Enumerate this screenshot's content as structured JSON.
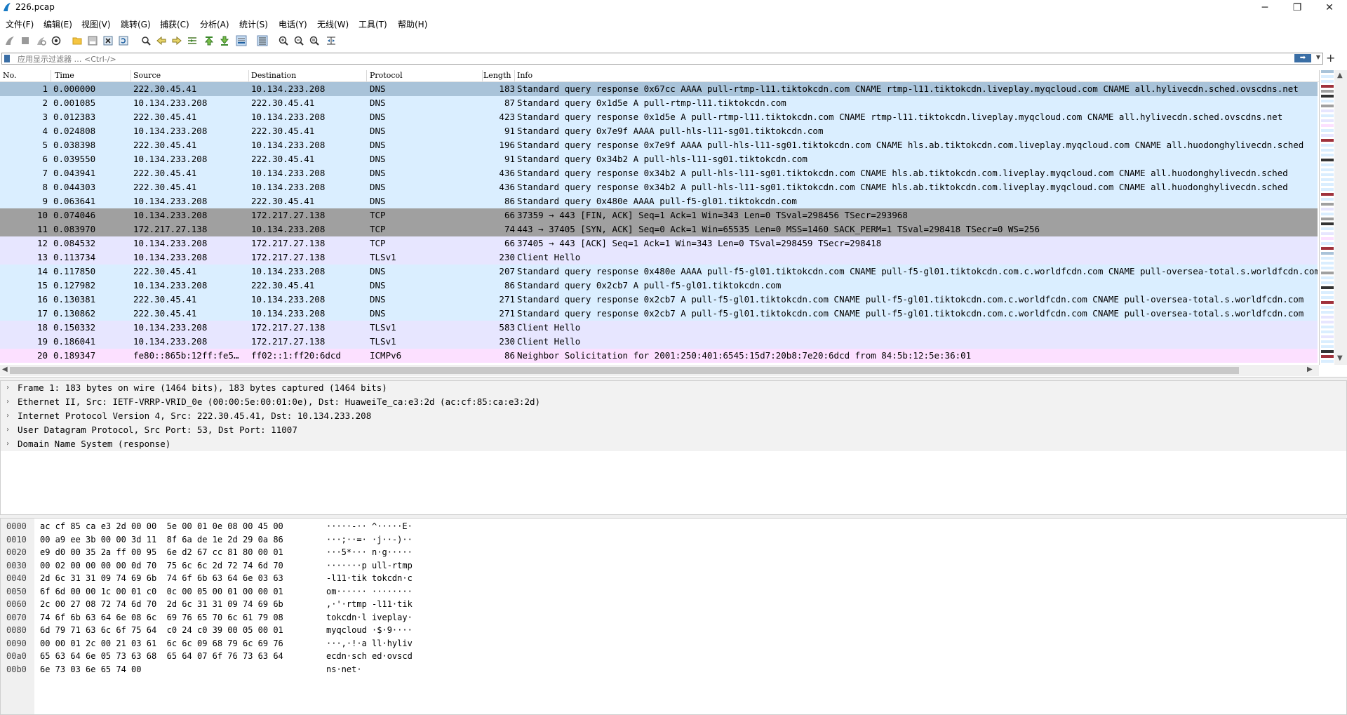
{
  "window": {
    "title": "226.pcap",
    "minimize": "─",
    "maximize": "❐",
    "close": "✕"
  },
  "menu": [
    "文件(F)",
    "编辑(E)",
    "视图(V)",
    "跳转(G)",
    "捕获(C)",
    "分析(A)",
    "统计(S)",
    "电话(Y)",
    "无线(W)",
    "工具(T)",
    "帮助(H)"
  ],
  "filter": {
    "placeholder": "应用显示过滤器 … <Ctrl-/>",
    "apply_label": "➡",
    "add_label": "+"
  },
  "packet_list": {
    "columns": [
      "No.",
      "Time",
      "Source",
      "Destination",
      "Protocol",
      "Length",
      "Info"
    ],
    "rows": [
      {
        "no": "1",
        "time": "0.000000",
        "src": "222.30.45.41",
        "dst": "10.134.233.208",
        "proto": "DNS",
        "len": "183",
        "info": "Standard query response 0x67cc AAAA pull-rtmp-l11.tiktokcdn.com CNAME rtmp-l11.tiktokcdn.liveplay.myqcloud.com CNAME all.hylivecdn.sched.ovscdns.net",
        "bg": "#a9c3d9"
      },
      {
        "no": "2",
        "time": "0.001085",
        "src": "10.134.233.208",
        "dst": "222.30.45.41",
        "proto": "DNS",
        "len": "87",
        "info": "Standard query 0x1d5e A pull-rtmp-l11.tiktokcdn.com",
        "bg": "#daeeff"
      },
      {
        "no": "3",
        "time": "0.012383",
        "src": "222.30.45.41",
        "dst": "10.134.233.208",
        "proto": "DNS",
        "len": "423",
        "info": "Standard query response 0x1d5e A pull-rtmp-l11.tiktokcdn.com CNAME rtmp-l11.tiktokcdn.liveplay.myqcloud.com CNAME all.hylivecdn.sched.ovscdns.net",
        "bg": "#daeeff"
      },
      {
        "no": "4",
        "time": "0.024808",
        "src": "10.134.233.208",
        "dst": "222.30.45.41",
        "proto": "DNS",
        "len": "91",
        "info": "Standard query 0x7e9f AAAA pull-hls-l11-sg01.tiktokcdn.com",
        "bg": "#daeeff"
      },
      {
        "no": "5",
        "time": "0.038398",
        "src": "222.30.45.41",
        "dst": "10.134.233.208",
        "proto": "DNS",
        "len": "196",
        "info": "Standard query response 0x7e9f AAAA pull-hls-l11-sg01.tiktokcdn.com CNAME hls.ab.tiktokcdn.com.liveplay.myqcloud.com CNAME all.huodonghylivecdn.sched",
        "bg": "#daeeff"
      },
      {
        "no": "6",
        "time": "0.039550",
        "src": "10.134.233.208",
        "dst": "222.30.45.41",
        "proto": "DNS",
        "len": "91",
        "info": "Standard query 0x34b2 A pull-hls-l11-sg01.tiktokcdn.com",
        "bg": "#daeeff"
      },
      {
        "no": "7",
        "time": "0.043941",
        "src": "222.30.45.41",
        "dst": "10.134.233.208",
        "proto": "DNS",
        "len": "436",
        "info": "Standard query response 0x34b2 A pull-hls-l11-sg01.tiktokcdn.com CNAME hls.ab.tiktokcdn.com.liveplay.myqcloud.com CNAME all.huodonghylivecdn.sched",
        "bg": "#daeeff"
      },
      {
        "no": "8",
        "time": "0.044303",
        "src": "222.30.45.41",
        "dst": "10.134.233.208",
        "proto": "DNS",
        "len": "436",
        "info": "Standard query response 0x34b2 A pull-hls-l11-sg01.tiktokcdn.com CNAME hls.ab.tiktokcdn.com.liveplay.myqcloud.com CNAME all.huodonghylivecdn.sched",
        "bg": "#daeeff"
      },
      {
        "no": "9",
        "time": "0.063641",
        "src": "10.134.233.208",
        "dst": "222.30.45.41",
        "proto": "DNS",
        "len": "86",
        "info": "Standard query 0x480e AAAA pull-f5-gl01.tiktokcdn.com",
        "bg": "#daeeff"
      },
      {
        "no": "10",
        "time": "0.074046",
        "src": "10.134.233.208",
        "dst": "172.217.27.138",
        "proto": "TCP",
        "len": "66",
        "info": "37359 → 443 [FIN, ACK] Seq=1 Ack=1 Win=343 Len=0 TSval=298456 TSecr=293968",
        "bg": "#a0a0a0"
      },
      {
        "no": "11",
        "time": "0.083970",
        "src": "172.217.27.138",
        "dst": "10.134.233.208",
        "proto": "TCP",
        "len": "74",
        "info": "443 → 37405 [SYN, ACK] Seq=0 Ack=1 Win=65535 Len=0 MSS=1460 SACK_PERM=1 TSval=298418 TSecr=0 WS=256",
        "bg": "#a0a0a0"
      },
      {
        "no": "12",
        "time": "0.084532",
        "src": "10.134.233.208",
        "dst": "172.217.27.138",
        "proto": "TCP",
        "len": "66",
        "info": "37405 → 443 [ACK] Seq=1 Ack=1 Win=343 Len=0 TSval=298459 TSecr=298418",
        "bg": "#e7e6ff"
      },
      {
        "no": "13",
        "time": "0.113734",
        "src": "10.134.233.208",
        "dst": "172.217.27.138",
        "proto": "TLSv1",
        "len": "230",
        "info": "Client Hello",
        "bg": "#e7e6ff"
      },
      {
        "no": "14",
        "time": "0.117850",
        "src": "222.30.45.41",
        "dst": "10.134.233.208",
        "proto": "DNS",
        "len": "207",
        "info": "Standard query response 0x480e AAAA pull-f5-gl01.tiktokcdn.com CNAME pull-f5-gl01.tiktokcdn.com.c.worldfcdn.com CNAME pull-oversea-total.s.worldfcdn.com",
        "bg": "#daeeff"
      },
      {
        "no": "15",
        "time": "0.127982",
        "src": "10.134.233.208",
        "dst": "222.30.45.41",
        "proto": "DNS",
        "len": "86",
        "info": "Standard query 0x2cb7 A pull-f5-gl01.tiktokcdn.com",
        "bg": "#daeeff"
      },
      {
        "no": "16",
        "time": "0.130381",
        "src": "222.30.45.41",
        "dst": "10.134.233.208",
        "proto": "DNS",
        "len": "271",
        "info": "Standard query response 0x2cb7 A pull-f5-gl01.tiktokcdn.com CNAME pull-f5-gl01.tiktokcdn.com.c.worldfcdn.com CNAME pull-oversea-total.s.worldfcdn.com",
        "bg": "#daeeff"
      },
      {
        "no": "17",
        "time": "0.130862",
        "src": "222.30.45.41",
        "dst": "10.134.233.208",
        "proto": "DNS",
        "len": "271",
        "info": "Standard query response 0x2cb7 A pull-f5-gl01.tiktokcdn.com CNAME pull-f5-gl01.tiktokcdn.com.c.worldfcdn.com CNAME pull-oversea-total.s.worldfcdn.com",
        "bg": "#daeeff"
      },
      {
        "no": "18",
        "time": "0.150332",
        "src": "10.134.233.208",
        "dst": "172.217.27.138",
        "proto": "TLSv1",
        "len": "583",
        "info": "Client Hello",
        "bg": "#e7e6ff"
      },
      {
        "no": "19",
        "time": "0.186041",
        "src": "10.134.233.208",
        "dst": "172.217.27.138",
        "proto": "TLSv1",
        "len": "230",
        "info": "Client Hello",
        "bg": "#e7e6ff"
      },
      {
        "no": "20",
        "time": "0.189347",
        "src": "fe80::865b:12ff:fe5…",
        "dst": "ff02::1:ff20:6dcd",
        "proto": "ICMPv6",
        "len": "86",
        "info": "Neighbor Solicitation for 2001:250:401:6545:15d7:20b8:7e20:6dcd from 84:5b:12:5e:36:01",
        "bg": "#fce0ff"
      }
    ]
  },
  "details": [
    "Frame 1: 183 bytes on wire (1464 bits), 183 bytes captured (1464 bits)",
    "Ethernet II, Src: IETF-VRRP-VRID_0e (00:00:5e:00:01:0e), Dst: HuaweiTe_ca:e3:2d (ac:cf:85:ca:e3:2d)",
    "Internet Protocol Version 4, Src: 222.30.45.41, Dst: 10.134.233.208",
    "User Datagram Protocol, Src Port: 53, Dst Port: 11007",
    "Domain Name System (response)"
  ],
  "bytes": [
    {
      "off": "0000",
      "hex": "ac cf 85 ca e3 2d 00 00  5e 00 01 0e 08 00 45 00",
      "ascii": "·····-·· ^·····E·"
    },
    {
      "off": "0010",
      "hex": "00 a9 ee 3b 00 00 3d 11  8f 6a de 1e 2d 29 0a 86",
      "ascii": "···;··=· ·j··-)··"
    },
    {
      "off": "0020",
      "hex": "e9 d0 00 35 2a ff 00 95  6e d2 67 cc 81 80 00 01",
      "ascii": "···5*··· n·g·····"
    },
    {
      "off": "0030",
      "hex": "00 02 00 00 00 00 0d 70  75 6c 6c 2d 72 74 6d 70",
      "ascii": "·······p ull-rtmp"
    },
    {
      "off": "0040",
      "hex": "2d 6c 31 31 09 74 69 6b  74 6f 6b 63 64 6e 03 63",
      "ascii": "-l11·tik tokcdn·c"
    },
    {
      "off": "0050",
      "hex": "6f 6d 00 00 1c 00 01 c0  0c 00 05 00 01 00 00 01",
      "ascii": "om······ ········"
    },
    {
      "off": "0060",
      "hex": "2c 00 27 08 72 74 6d 70  2d 6c 31 31 09 74 69 6b",
      "ascii": ",·'·rtmp -l11·tik"
    },
    {
      "off": "0070",
      "hex": "74 6f 6b 63 64 6e 08 6c  69 76 65 70 6c 61 79 08",
      "ascii": "tokcdn·l iveplay·"
    },
    {
      "off": "0080",
      "hex": "6d 79 71 63 6c 6f 75 64  c0 24 c0 39 00 05 00 01",
      "ascii": "myqcloud ·$·9····"
    },
    {
      "off": "0090",
      "hex": "00 00 01 2c 00 21 03 61  6c 6c 09 68 79 6c 69 76",
      "ascii": "···,·!·a ll·hyliv"
    },
    {
      "off": "00a0",
      "hex": "65 63 64 6e 05 73 63 68  65 64 07 6f 76 73 63 64",
      "ascii": "ecdn·sch ed·ovscd"
    },
    {
      "off": "00b0",
      "hex": "6e 73 03 6e 65 74 00",
      "ascii": "ns·net·"
    }
  ],
  "colors": {
    "selected": "#a9c3d9",
    "dns": "#daeeff",
    "tcp_dark": "#a0a0a0",
    "tls": "#e7e6ff",
    "icmpv6": "#fce0ff"
  }
}
